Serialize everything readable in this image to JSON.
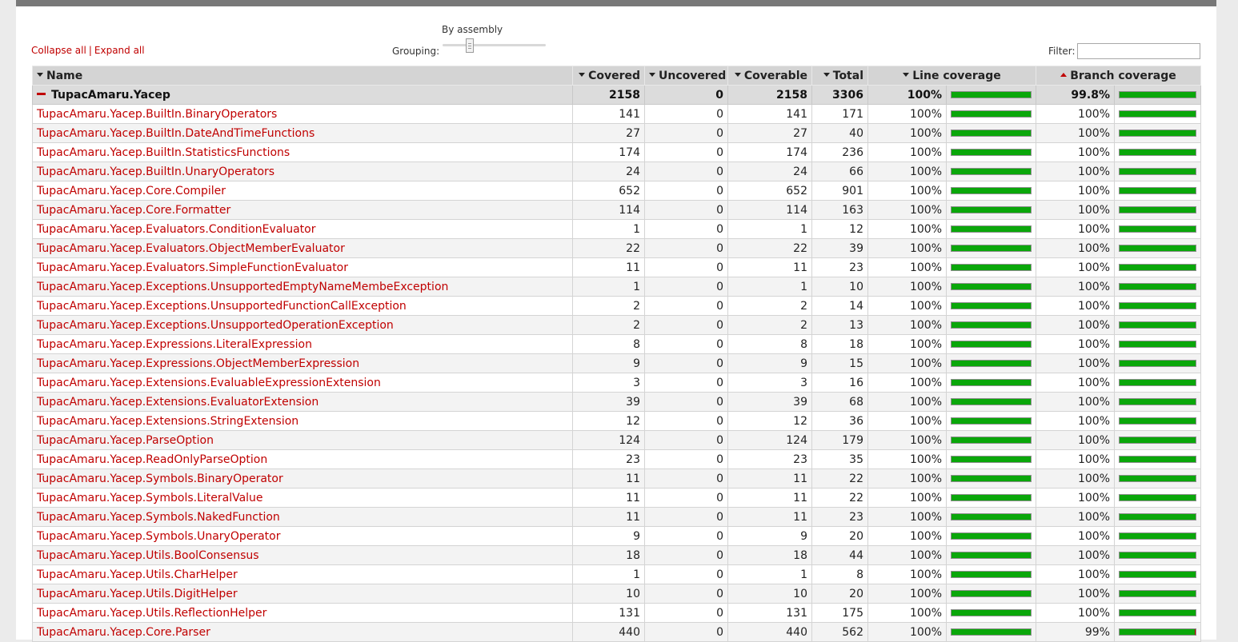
{
  "toolbar": {
    "collapse_all": "Collapse all",
    "separator": "|",
    "expand_all": "Expand all",
    "grouping_title": "By assembly",
    "grouping_label": "Grouping:",
    "filter_label": "Filter:",
    "filter_value": ""
  },
  "colors": {
    "link": "#c00000",
    "covered": "#0aa70a",
    "uncovered": "#c00000",
    "header_bg": "#d4d4d4"
  },
  "table": {
    "columns": {
      "name": "Name",
      "covered": "Covered",
      "uncovered": "Uncovered",
      "coverable": "Coverable",
      "total": "Total",
      "line_coverage": "Line coverage",
      "branch_coverage": "Branch coverage"
    },
    "assembly": {
      "name": "TupacAmaru.Yacep",
      "covered": "2158",
      "uncovered": "0",
      "coverable": "2158",
      "total": "3306",
      "line_pct": "100%",
      "line_frac": 1,
      "branch_pct": "99.8%",
      "branch_frac": 0.998
    },
    "rows": [
      {
        "name": "TupacAmaru.Yacep.BuiltIn.BinaryOperators",
        "covered": "141",
        "uncovered": "0",
        "coverable": "141",
        "total": "171",
        "line_pct": "100%",
        "line_frac": 1,
        "branch_pct": "100%",
        "branch_frac": 1
      },
      {
        "name": "TupacAmaru.Yacep.BuiltIn.DateAndTimeFunctions",
        "covered": "27",
        "uncovered": "0",
        "coverable": "27",
        "total": "40",
        "line_pct": "100%",
        "line_frac": 1,
        "branch_pct": "100%",
        "branch_frac": 1
      },
      {
        "name": "TupacAmaru.Yacep.BuiltIn.StatisticsFunctions",
        "covered": "174",
        "uncovered": "0",
        "coverable": "174",
        "total": "236",
        "line_pct": "100%",
        "line_frac": 1,
        "branch_pct": "100%",
        "branch_frac": 1
      },
      {
        "name": "TupacAmaru.Yacep.BuiltIn.UnaryOperators",
        "covered": "24",
        "uncovered": "0",
        "coverable": "24",
        "total": "66",
        "line_pct": "100%",
        "line_frac": 1,
        "branch_pct": "100%",
        "branch_frac": 1
      },
      {
        "name": "TupacAmaru.Yacep.Core.Compiler",
        "covered": "652",
        "uncovered": "0",
        "coverable": "652",
        "total": "901",
        "line_pct": "100%",
        "line_frac": 1,
        "branch_pct": "100%",
        "branch_frac": 1
      },
      {
        "name": "TupacAmaru.Yacep.Core.Formatter",
        "covered": "114",
        "uncovered": "0",
        "coverable": "114",
        "total": "163",
        "line_pct": "100%",
        "line_frac": 1,
        "branch_pct": "100%",
        "branch_frac": 1
      },
      {
        "name": "TupacAmaru.Yacep.Evaluators.ConditionEvaluator",
        "covered": "1",
        "uncovered": "0",
        "coverable": "1",
        "total": "12",
        "line_pct": "100%",
        "line_frac": 1,
        "branch_pct": "100%",
        "branch_frac": 1
      },
      {
        "name": "TupacAmaru.Yacep.Evaluators.ObjectMemberEvaluator",
        "covered": "22",
        "uncovered": "0",
        "coverable": "22",
        "total": "39",
        "line_pct": "100%",
        "line_frac": 1,
        "branch_pct": "100%",
        "branch_frac": 1
      },
      {
        "name": "TupacAmaru.Yacep.Evaluators.SimpleFunctionEvaluator",
        "covered": "11",
        "uncovered": "0",
        "coverable": "11",
        "total": "23",
        "line_pct": "100%",
        "line_frac": 1,
        "branch_pct": "100%",
        "branch_frac": 1
      },
      {
        "name": "TupacAmaru.Yacep.Exceptions.UnsupportedEmptyNameMembeException",
        "covered": "1",
        "uncovered": "0",
        "coverable": "1",
        "total": "10",
        "line_pct": "100%",
        "line_frac": 1,
        "branch_pct": "100%",
        "branch_frac": 1
      },
      {
        "name": "TupacAmaru.Yacep.Exceptions.UnsupportedFunctionCallException",
        "covered": "2",
        "uncovered": "0",
        "coverable": "2",
        "total": "14",
        "line_pct": "100%",
        "line_frac": 1,
        "branch_pct": "100%",
        "branch_frac": 1
      },
      {
        "name": "TupacAmaru.Yacep.Exceptions.UnsupportedOperationException",
        "covered": "2",
        "uncovered": "0",
        "coverable": "2",
        "total": "13",
        "line_pct": "100%",
        "line_frac": 1,
        "branch_pct": "100%",
        "branch_frac": 1
      },
      {
        "name": "TupacAmaru.Yacep.Expressions.LiteralExpression",
        "covered": "8",
        "uncovered": "0",
        "coverable": "8",
        "total": "18",
        "line_pct": "100%",
        "line_frac": 1,
        "branch_pct": "100%",
        "branch_frac": 1
      },
      {
        "name": "TupacAmaru.Yacep.Expressions.ObjectMemberExpression",
        "covered": "9",
        "uncovered": "0",
        "coverable": "9",
        "total": "15",
        "line_pct": "100%",
        "line_frac": 1,
        "branch_pct": "100%",
        "branch_frac": 1
      },
      {
        "name": "TupacAmaru.Yacep.Extensions.EvaluableExpressionExtension",
        "covered": "3",
        "uncovered": "0",
        "coverable": "3",
        "total": "16",
        "line_pct": "100%",
        "line_frac": 1,
        "branch_pct": "100%",
        "branch_frac": 1
      },
      {
        "name": "TupacAmaru.Yacep.Extensions.EvaluatorExtension",
        "covered": "39",
        "uncovered": "0",
        "coverable": "39",
        "total": "68",
        "line_pct": "100%",
        "line_frac": 1,
        "branch_pct": "100%",
        "branch_frac": 1
      },
      {
        "name": "TupacAmaru.Yacep.Extensions.StringExtension",
        "covered": "12",
        "uncovered": "0",
        "coverable": "12",
        "total": "36",
        "line_pct": "100%",
        "line_frac": 1,
        "branch_pct": "100%",
        "branch_frac": 1
      },
      {
        "name": "TupacAmaru.Yacep.ParseOption",
        "covered": "124",
        "uncovered": "0",
        "coverable": "124",
        "total": "179",
        "line_pct": "100%",
        "line_frac": 1,
        "branch_pct": "100%",
        "branch_frac": 1
      },
      {
        "name": "TupacAmaru.Yacep.ReadOnlyParseOption",
        "covered": "23",
        "uncovered": "0",
        "coverable": "23",
        "total": "35",
        "line_pct": "100%",
        "line_frac": 1,
        "branch_pct": "100%",
        "branch_frac": 1
      },
      {
        "name": "TupacAmaru.Yacep.Symbols.BinaryOperator",
        "covered": "11",
        "uncovered": "0",
        "coverable": "11",
        "total": "22",
        "line_pct": "100%",
        "line_frac": 1,
        "branch_pct": "100%",
        "branch_frac": 1
      },
      {
        "name": "TupacAmaru.Yacep.Symbols.LiteralValue",
        "covered": "11",
        "uncovered": "0",
        "coverable": "11",
        "total": "22",
        "line_pct": "100%",
        "line_frac": 1,
        "branch_pct": "100%",
        "branch_frac": 1
      },
      {
        "name": "TupacAmaru.Yacep.Symbols.NakedFunction",
        "covered": "11",
        "uncovered": "0",
        "coverable": "11",
        "total": "23",
        "line_pct": "100%",
        "line_frac": 1,
        "branch_pct": "100%",
        "branch_frac": 1
      },
      {
        "name": "TupacAmaru.Yacep.Symbols.UnaryOperator",
        "covered": "9",
        "uncovered": "0",
        "coverable": "9",
        "total": "20",
        "line_pct": "100%",
        "line_frac": 1,
        "branch_pct": "100%",
        "branch_frac": 1
      },
      {
        "name": "TupacAmaru.Yacep.Utils.BoolConsensus",
        "covered": "18",
        "uncovered": "0",
        "coverable": "18",
        "total": "44",
        "line_pct": "100%",
        "line_frac": 1,
        "branch_pct": "100%",
        "branch_frac": 1
      },
      {
        "name": "TupacAmaru.Yacep.Utils.CharHelper",
        "covered": "1",
        "uncovered": "0",
        "coverable": "1",
        "total": "8",
        "line_pct": "100%",
        "line_frac": 1,
        "branch_pct": "100%",
        "branch_frac": 1
      },
      {
        "name": "TupacAmaru.Yacep.Utils.DigitHelper",
        "covered": "10",
        "uncovered": "0",
        "coverable": "10",
        "total": "20",
        "line_pct": "100%",
        "line_frac": 1,
        "branch_pct": "100%",
        "branch_frac": 1
      },
      {
        "name": "TupacAmaru.Yacep.Utils.ReflectionHelper",
        "covered": "131",
        "uncovered": "0",
        "coverable": "131",
        "total": "175",
        "line_pct": "100%",
        "line_frac": 1,
        "branch_pct": "100%",
        "branch_frac": 1
      },
      {
        "name": "TupacAmaru.Yacep.Core.Parser",
        "covered": "440",
        "uncovered": "0",
        "coverable": "440",
        "total": "562",
        "line_pct": "100%",
        "line_frac": 1,
        "branch_pct": "99%",
        "branch_frac": 0.99
      }
    ]
  }
}
